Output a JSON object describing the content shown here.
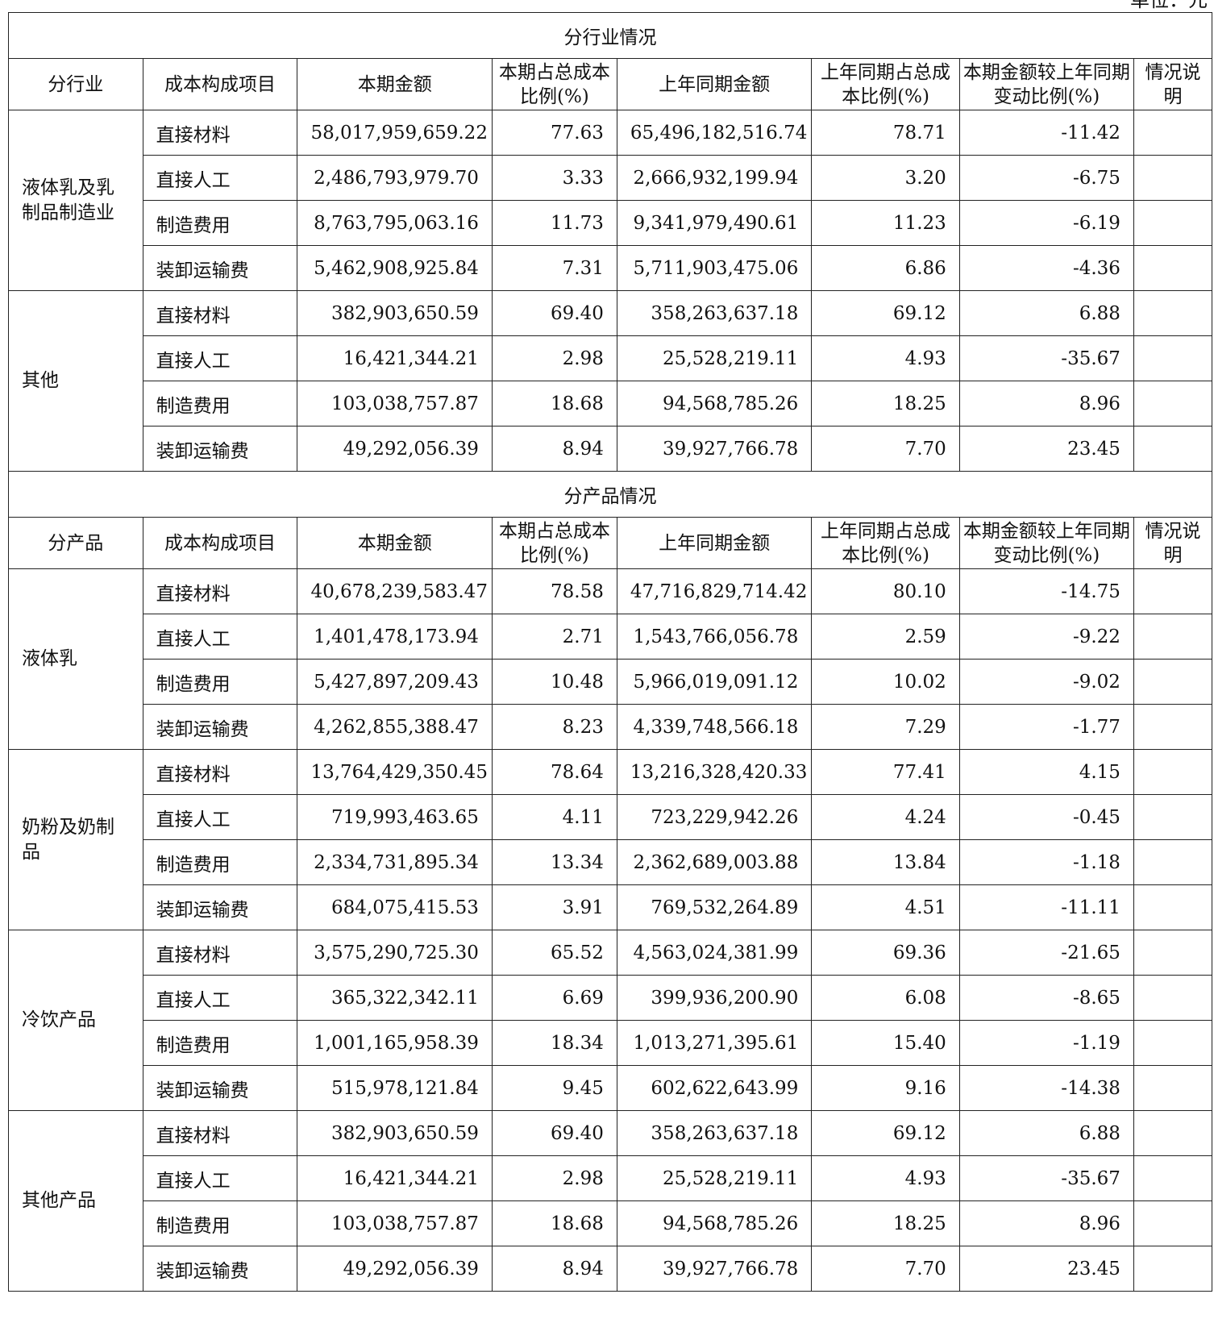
{
  "unit_note": "单位：元",
  "headers": {
    "amount": "本期金额",
    "share": "本期占总成本比例(%)",
    "last_amount": "上年同期金额",
    "last_share": "上年同期占总成本比例(%)",
    "change": "本期金额较上年同期变动比例(%)",
    "note": "情况说明"
  },
  "sections": [
    {
      "title": "分行业情况",
      "first_col_header": "分行业",
      "item_col_header": "成本构成项目",
      "groups": [
        {
          "name": "液体乳及乳制品制造业",
          "rows": [
            {
              "item": "直接材料",
              "amount": "58,017,959,659.22",
              "share": "77.63",
              "last_amount": "65,496,182,516.74",
              "last_share": "78.71",
              "change": "-11.42",
              "note": ""
            },
            {
              "item": "直接人工",
              "amount": "2,486,793,979.70",
              "share": "3.33",
              "last_amount": "2,666,932,199.94",
              "last_share": "3.20",
              "change": "-6.75",
              "note": ""
            },
            {
              "item": "制造费用",
              "amount": "8,763,795,063.16",
              "share": "11.73",
              "last_amount": "9,341,979,490.61",
              "last_share": "11.23",
              "change": "-6.19",
              "note": ""
            },
            {
              "item": "装卸运输费",
              "amount": "5,462,908,925.84",
              "share": "7.31",
              "last_amount": "5,711,903,475.06",
              "last_share": "6.86",
              "change": "-4.36",
              "note": ""
            }
          ]
        },
        {
          "name": "其他",
          "rows": [
            {
              "item": "直接材料",
              "amount": "382,903,650.59",
              "share": "69.40",
              "last_amount": "358,263,637.18",
              "last_share": "69.12",
              "change": "6.88",
              "note": ""
            },
            {
              "item": "直接人工",
              "amount": "16,421,344.21",
              "share": "2.98",
              "last_amount": "25,528,219.11",
              "last_share": "4.93",
              "change": "-35.67",
              "note": ""
            },
            {
              "item": "制造费用",
              "amount": "103,038,757.87",
              "share": "18.68",
              "last_amount": "94,568,785.26",
              "last_share": "18.25",
              "change": "8.96",
              "note": ""
            },
            {
              "item": "装卸运输费",
              "amount": "49,292,056.39",
              "share": "8.94",
              "last_amount": "39,927,766.78",
              "last_share": "7.70",
              "change": "23.45",
              "note": ""
            }
          ]
        }
      ]
    },
    {
      "title": "分产品情况",
      "first_col_header": "分产品",
      "item_col_header": "成本构成项目",
      "groups": [
        {
          "name": "液体乳",
          "rows": [
            {
              "item": "直接材料",
              "amount": "40,678,239,583.47",
              "share": "78.58",
              "last_amount": "47,716,829,714.42",
              "last_share": "80.10",
              "change": "-14.75",
              "note": ""
            },
            {
              "item": "直接人工",
              "amount": "1,401,478,173.94",
              "share": "2.71",
              "last_amount": "1,543,766,056.78",
              "last_share": "2.59",
              "change": "-9.22",
              "note": ""
            },
            {
              "item": "制造费用",
              "amount": "5,427,897,209.43",
              "share": "10.48",
              "last_amount": "5,966,019,091.12",
              "last_share": "10.02",
              "change": "-9.02",
              "note": ""
            },
            {
              "item": "装卸运输费",
              "amount": "4,262,855,388.47",
              "share": "8.23",
              "last_amount": "4,339,748,566.18",
              "last_share": "7.29",
              "change": "-1.77",
              "note": ""
            }
          ]
        },
        {
          "name": "奶粉及奶制品",
          "rows": [
            {
              "item": "直接材料",
              "amount": "13,764,429,350.45",
              "share": "78.64",
              "last_amount": "13,216,328,420.33",
              "last_share": "77.41",
              "change": "4.15",
              "note": ""
            },
            {
              "item": "直接人工",
              "amount": "719,993,463.65",
              "share": "4.11",
              "last_amount": "723,229,942.26",
              "last_share": "4.24",
              "change": "-0.45",
              "note": ""
            },
            {
              "item": "制造费用",
              "amount": "2,334,731,895.34",
              "share": "13.34",
              "last_amount": "2,362,689,003.88",
              "last_share": "13.84",
              "change": "-1.18",
              "note": ""
            },
            {
              "item": "装卸运输费",
              "amount": "684,075,415.53",
              "share": "3.91",
              "last_amount": "769,532,264.89",
              "last_share": "4.51",
              "change": "-11.11",
              "note": ""
            }
          ]
        },
        {
          "name": "冷饮产品",
          "rows": [
            {
              "item": "直接材料",
              "amount": "3,575,290,725.30",
              "share": "65.52",
              "last_amount": "4,563,024,381.99",
              "last_share": "69.36",
              "change": "-21.65",
              "note": ""
            },
            {
              "item": "直接人工",
              "amount": "365,322,342.11",
              "share": "6.69",
              "last_amount": "399,936,200.90",
              "last_share": "6.08",
              "change": "-8.65",
              "note": ""
            },
            {
              "item": "制造费用",
              "amount": "1,001,165,958.39",
              "share": "18.34",
              "last_amount": "1,013,271,395.61",
              "last_share": "15.40",
              "change": "-1.19",
              "note": ""
            },
            {
              "item": "装卸运输费",
              "amount": "515,978,121.84",
              "share": "9.45",
              "last_amount": "602,622,643.99",
              "last_share": "9.16",
              "change": "-14.38",
              "note": ""
            }
          ]
        },
        {
          "name": "其他产品",
          "rows": [
            {
              "item": "直接材料",
              "amount": "382,903,650.59",
              "share": "69.40",
              "last_amount": "358,263,637.18",
              "last_share": "69.12",
              "change": "6.88",
              "note": ""
            },
            {
              "item": "直接人工",
              "amount": "16,421,344.21",
              "share": "2.98",
              "last_amount": "25,528,219.11",
              "last_share": "4.93",
              "change": "-35.67",
              "note": ""
            },
            {
              "item": "制造费用",
              "amount": "103,038,757.87",
              "share": "18.68",
              "last_amount": "94,568,785.26",
              "last_share": "18.25",
              "change": "8.96",
              "note": ""
            },
            {
              "item": "装卸运输费",
              "amount": "49,292,056.39",
              "share": "8.94",
              "last_amount": "39,927,766.78",
              "last_share": "7.70",
              "change": "23.45",
              "note": ""
            }
          ]
        }
      ]
    }
  ]
}
